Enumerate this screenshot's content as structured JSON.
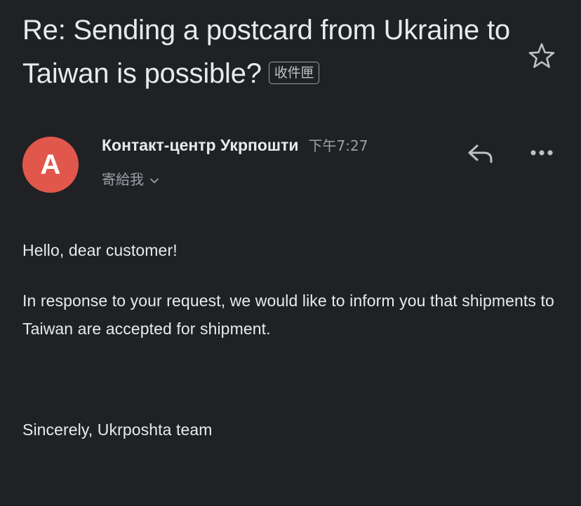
{
  "email": {
    "subject": "Re: Sending a postcard from Ukraine to Taiwan is possible?",
    "label_chip": "收件匣",
    "sender": {
      "avatar_letter": "A",
      "avatar_color": "#e2574c",
      "name": "Контакт-центр Укрпошти",
      "time": "下午7:27",
      "recipient": "寄給我"
    },
    "body": {
      "greeting": "Hello, dear customer!",
      "paragraph": "In response to your request, we would like to inform you that shipments to Taiwan are accepted for shipment.",
      "signature": "Sincerely, Ukrposhta team"
    }
  },
  "icons": {
    "star": "star-icon",
    "reply": "reply-icon",
    "more": "more-icon",
    "chevron": "chevron-down-icon"
  },
  "colors": {
    "background": "#202124",
    "text_primary": "#e8eaed",
    "text_secondary": "#9aa0a6"
  }
}
